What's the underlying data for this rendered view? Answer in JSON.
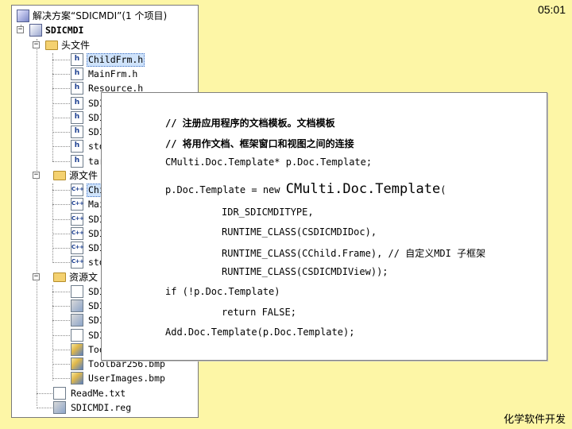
{
  "clock": "05:01",
  "footer": "化学软件开发",
  "explorer": {
    "solution_label": "解决方案“SDICMDI”(1 个项目)",
    "project_label": "SDICMDI",
    "headers_folder": "头文件",
    "headers": [
      "ChildFrm.h",
      "MainFrm.h",
      "Resource.h",
      "SDI",
      "SDI",
      "SDI",
      "std",
      "tar"
    ],
    "sources_folder": "源文件",
    "sources": [
      "Chi",
      "Mai",
      "SDI",
      "SDI",
      "SDI",
      "std"
    ],
    "resources_folder": "资源文",
    "resources": [
      "SDI",
      "SDI",
      "SDI",
      "SDI",
      "Too",
      "Toolbar256.bmp",
      "UserImages.bmp"
    ],
    "readme": "ReadMe.txt",
    "reg": "SDICMDI.reg"
  },
  "code": {
    "comment1": "// 注册应用程序的文档模板。文档模板",
    "comment2": "// 将用作文档、框架窗口和视图之间的连接",
    "decl": "CMulti.Doc.Template* p.Doc.Template;",
    "assign_prefix": "p.Doc.Template = new ",
    "assign_class": "CMulti.Doc.Template",
    "assign_paren": "(",
    "arg1": "IDR_SDICMDITYPE,",
    "arg2": "RUNTIME_CLASS(CSDICMDIDoc),",
    "arg3": "RUNTIME_CLASS(CChild.Frame), // 自定义MDI 子框架",
    "arg4": "RUNTIME_CLASS(CSDICMDIView));",
    "if_line": "if (!p.Doc.Template)",
    "return_line": "return FALSE;",
    "add_line": "Add.Doc.Template(p.Doc.Template);"
  },
  "icons": {
    "header_file": "h",
    "source_file": "C++"
  }
}
